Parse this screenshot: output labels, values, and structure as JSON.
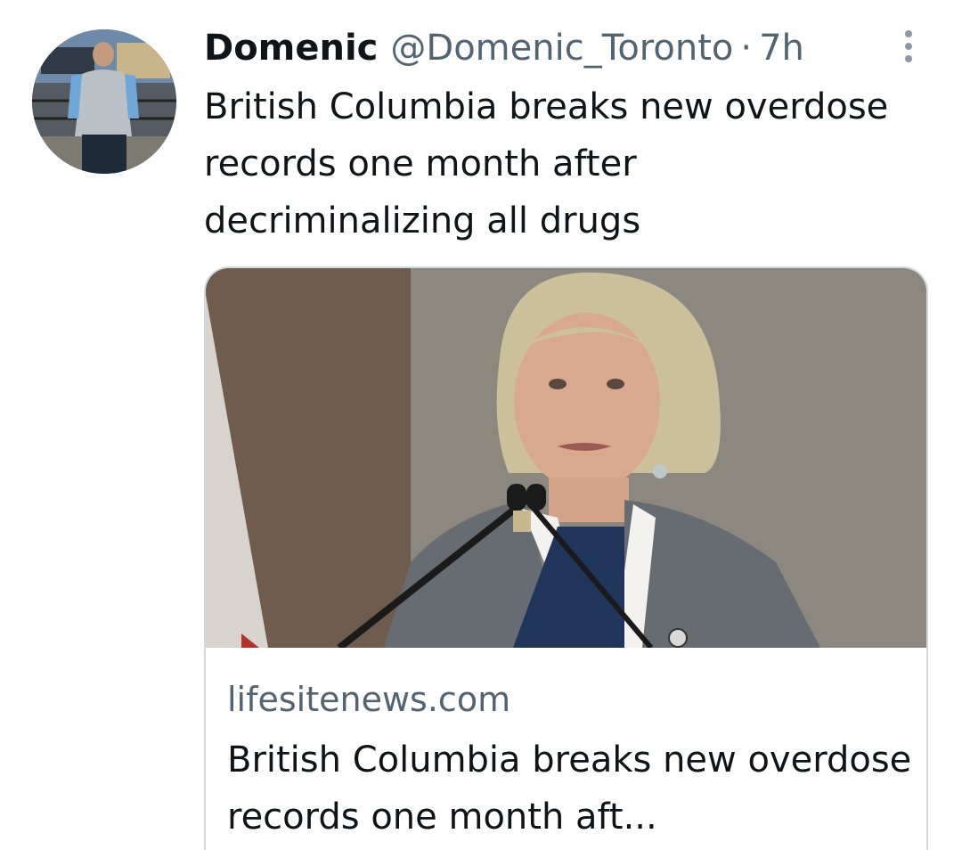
{
  "tweet": {
    "author_name": "Domenic",
    "author_handle": "@Domenic_Toronto",
    "separator": "·",
    "time": "7h",
    "text": "British Columbia breaks new overdose records one month after decriminalizing all drugs"
  },
  "link_card": {
    "domain": "lifesitenews.com",
    "title": "British Columbia breaks new overdose records one month aft..."
  },
  "icons": {
    "more": "more-vertical-dots-icon",
    "avatar": "profile-photo"
  },
  "colors": {
    "text_primary": "#0f1419",
    "text_secondary": "#536471",
    "card_border": "#cfd9de"
  }
}
